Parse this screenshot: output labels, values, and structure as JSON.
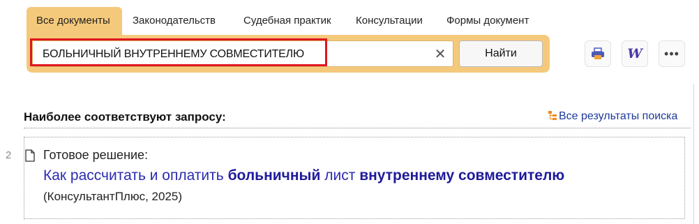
{
  "tabs": [
    {
      "label": "Все документы",
      "active": true
    },
    {
      "label": "Законодательств",
      "active": false
    },
    {
      "label": "Судебная практик",
      "active": false
    },
    {
      "label": "Консультации",
      "active": false
    },
    {
      "label": "Формы документ",
      "active": false
    }
  ],
  "search": {
    "query": "БОЛЬНИЧНЫЙ ВНУТРЕННЕМУ СОВМЕСТИТЕЛЮ",
    "find_label": "Найти",
    "clear_icon": "close-icon"
  },
  "toolbar": {
    "icons": [
      "print-icon",
      "word-export-icon",
      "more-icon"
    ],
    "word_glyph": "W",
    "more_glyph": "•••"
  },
  "results": {
    "title": "Наиболее соответствуют запросу:",
    "all_results_label": "Все результаты поиска",
    "items": [
      {
        "number": "2",
        "kind": "Готовое решение:",
        "link_parts": [
          {
            "text": "Как рассчитать и оплатить ",
            "bold": false
          },
          {
            "text": "больничный",
            "bold": true
          },
          {
            "text": " лист ",
            "bold": false
          },
          {
            "text": "внутреннему совместителю",
            "bold": true
          }
        ],
        "source": "(КонсультантПлюс, 2025)"
      }
    ]
  },
  "colors": {
    "accent": "#f5c97b",
    "highlight_border": "#e0161e",
    "link": "#2b2bb0"
  }
}
